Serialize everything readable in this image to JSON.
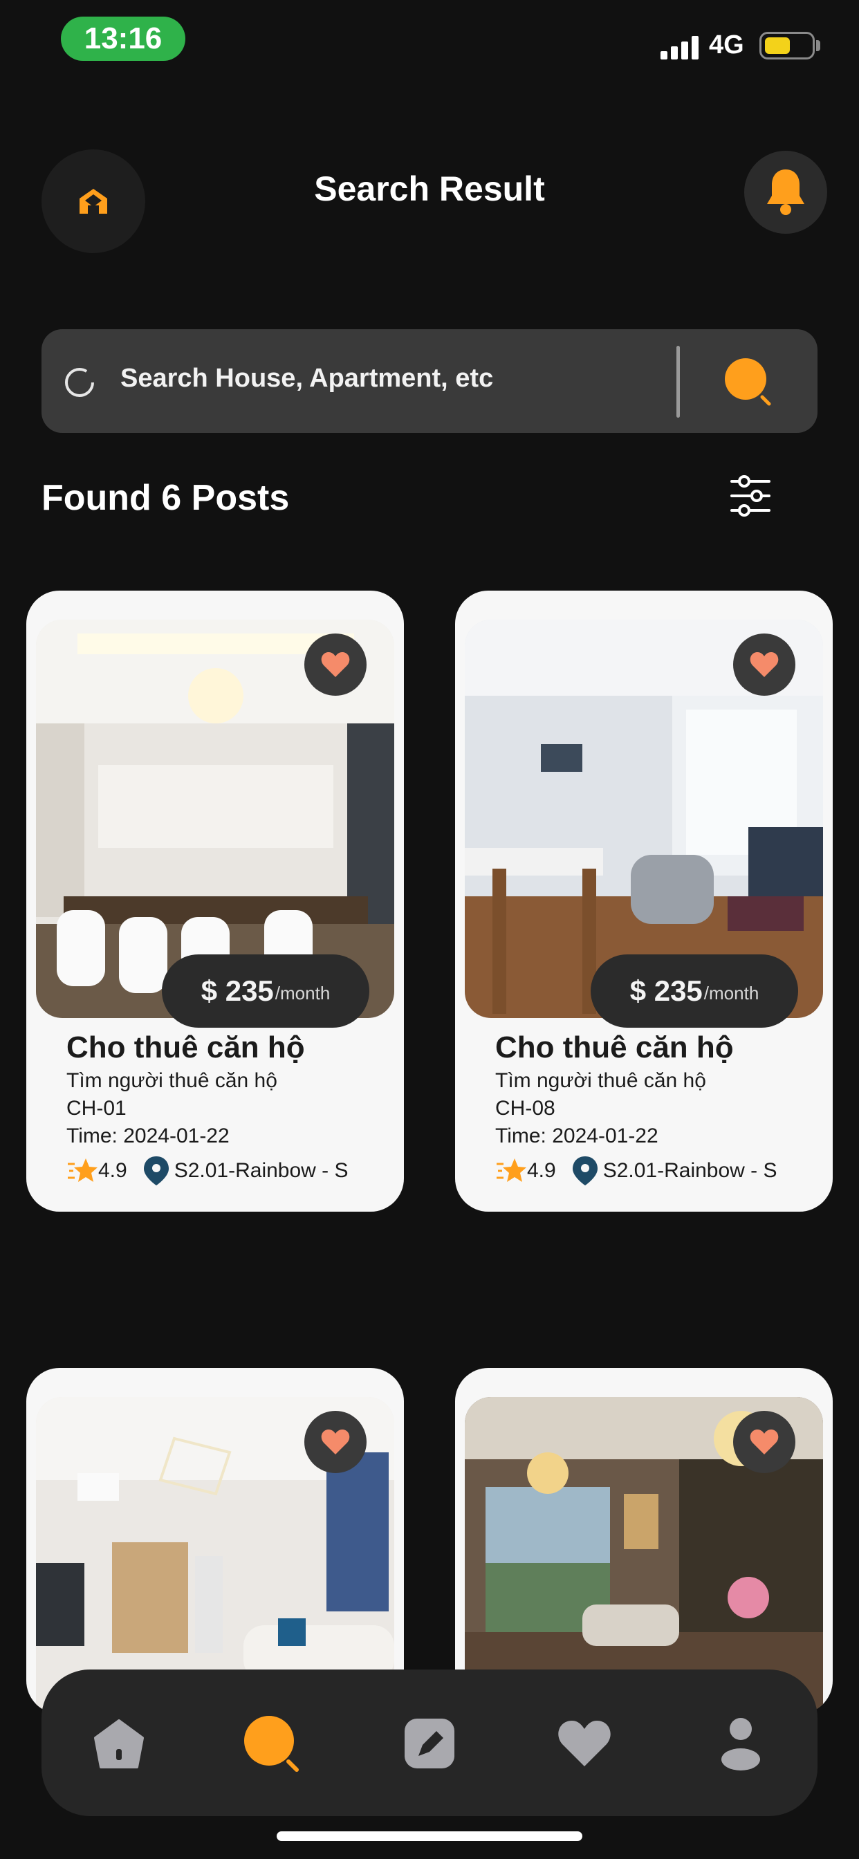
{
  "status_bar": {
    "time": "13:16",
    "network": "4G"
  },
  "header": {
    "title": "Search Result"
  },
  "search": {
    "placeholder": "Search House, Apartment, etc"
  },
  "results": {
    "found_label": "Found 6 Posts"
  },
  "colors": {
    "accent": "#ff9f1c",
    "heart": "#f58b6a",
    "pin": "#1e4a66",
    "background": "#111111",
    "card": "#f7f7f7"
  },
  "listings": [
    {
      "price": "$ 235",
      "period": "/month",
      "title": "Cho thuê căn hộ",
      "subtitle": "Tìm người thuê căn hộ",
      "code": "CH-01",
      "time": "Time: 2024-01-22",
      "rating": "4.9",
      "location": "S2.01-Rainbow - S"
    },
    {
      "price": "$ 235",
      "period": "/month",
      "title": "Cho thuê căn hộ",
      "subtitle": "Tìm người thuê căn hộ",
      "code": "CH-08",
      "time": "Time: 2024-01-22",
      "rating": "4.9",
      "location": "S2.01-Rainbow - S"
    },
    {},
    {}
  ],
  "nav": {
    "items": [
      {
        "icon": "home-icon"
      },
      {
        "icon": "search-icon",
        "active": true
      },
      {
        "icon": "edit-icon"
      },
      {
        "icon": "heart-icon"
      },
      {
        "icon": "profile-icon"
      }
    ]
  }
}
